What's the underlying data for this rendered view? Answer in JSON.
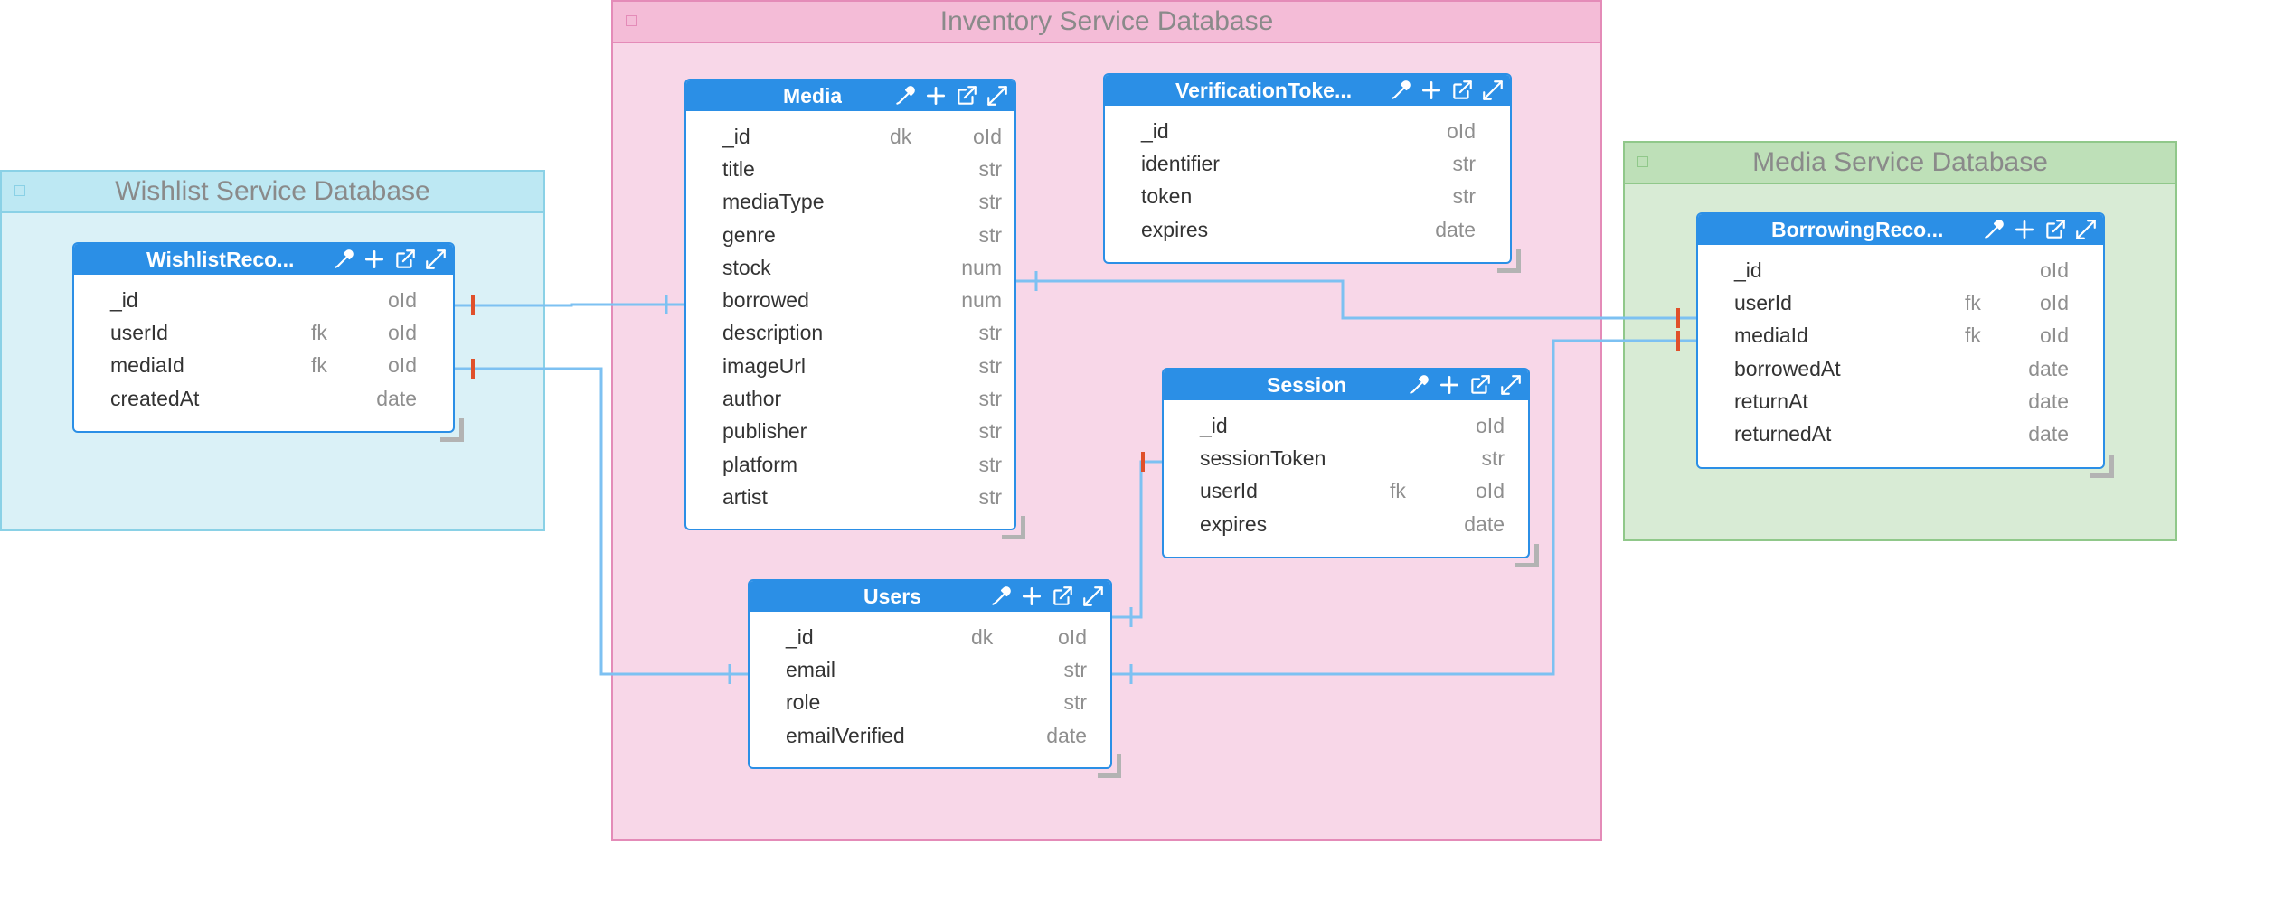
{
  "groups": {
    "inventory": {
      "title": "Inventory Service Database"
    },
    "wishlist": {
      "title": "Wishlist Service Database"
    },
    "media_service": {
      "title": "Media Service Database"
    }
  },
  "icons": [
    "eyedropper-icon",
    "plus-icon",
    "open-external-icon",
    "expand-icon"
  ],
  "colors": {
    "header": "#2b8fe6",
    "connector": "#7dc1f2",
    "cardinality_marker": "#e0502b",
    "inventory_fill": "#f8d7e8",
    "wishlist_fill": "#daf1f7",
    "media_fill": "#d8ebd5"
  },
  "tables": {
    "media": {
      "name": "Media",
      "rows": [
        {
          "name": "_id",
          "key": "dk",
          "type": "oId"
        },
        {
          "name": "title",
          "key": "",
          "type": "str"
        },
        {
          "name": "mediaType",
          "key": "",
          "type": "str"
        },
        {
          "name": "genre",
          "key": "",
          "type": "str"
        },
        {
          "name": "stock",
          "key": "",
          "type": "num"
        },
        {
          "name": "borrowed",
          "key": "",
          "type": "num"
        },
        {
          "name": "description",
          "key": "",
          "type": "str"
        },
        {
          "name": "imageUrl",
          "key": "",
          "type": "str"
        },
        {
          "name": "author",
          "key": "",
          "type": "str"
        },
        {
          "name": "publisher",
          "key": "",
          "type": "str"
        },
        {
          "name": "platform",
          "key": "",
          "type": "str"
        },
        {
          "name": "artist",
          "key": "",
          "type": "str"
        }
      ]
    },
    "verification": {
      "name": "VerificationToke...",
      "rows": [
        {
          "name": "_id",
          "key": "",
          "type": "oId"
        },
        {
          "name": "identifier",
          "key": "",
          "type": "str"
        },
        {
          "name": "token",
          "key": "",
          "type": "str"
        },
        {
          "name": "expires",
          "key": "",
          "type": "date"
        }
      ]
    },
    "session": {
      "name": "Session",
      "rows": [
        {
          "name": "_id",
          "key": "",
          "type": "oId"
        },
        {
          "name": "sessionToken",
          "key": "",
          "type": "str"
        },
        {
          "name": "userId",
          "key": "fk",
          "type": "oId"
        },
        {
          "name": "expires",
          "key": "",
          "type": "date"
        }
      ]
    },
    "users": {
      "name": "Users",
      "rows": [
        {
          "name": "_id",
          "key": "dk",
          "type": "oId"
        },
        {
          "name": "email",
          "key": "",
          "type": "str"
        },
        {
          "name": "role",
          "key": "",
          "type": "str"
        },
        {
          "name": "emailVerified",
          "key": "",
          "type": "date"
        }
      ]
    },
    "wishlist": {
      "name": "WishlistReco...",
      "rows": [
        {
          "name": "_id",
          "key": "",
          "type": "oId"
        },
        {
          "name": "userId",
          "key": "fk",
          "type": "oId"
        },
        {
          "name": "mediaId",
          "key": "fk",
          "type": "oId"
        },
        {
          "name": "createdAt",
          "key": "",
          "type": "date"
        }
      ]
    },
    "borrowing": {
      "name": "BorrowingReco...",
      "rows": [
        {
          "name": "_id",
          "key": "",
          "type": "oId"
        },
        {
          "name": "userId",
          "key": "fk",
          "type": "oId"
        },
        {
          "name": "mediaId",
          "key": "fk",
          "type": "oId"
        },
        {
          "name": "borrowedAt",
          "key": "",
          "type": "date"
        },
        {
          "name": "returnAt",
          "key": "",
          "type": "date"
        },
        {
          "name": "returnedAt",
          "key": "",
          "type": "date"
        }
      ]
    }
  }
}
